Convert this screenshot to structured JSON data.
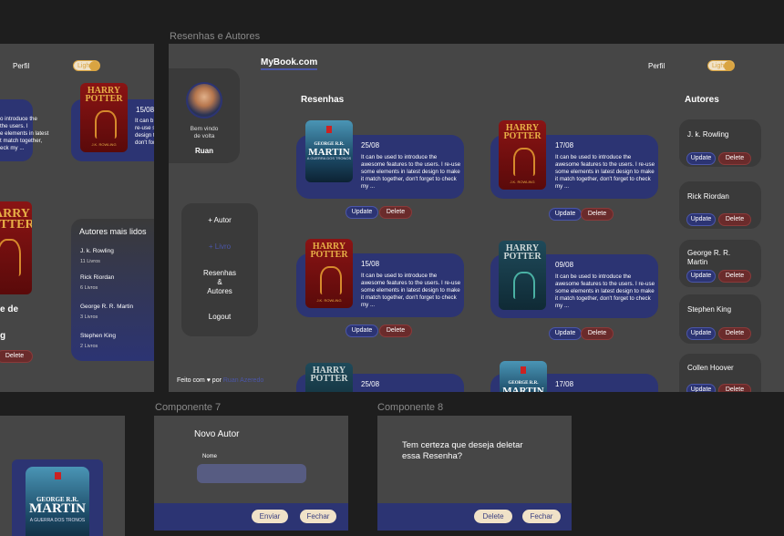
{
  "colors": {
    "background": "#1e1e1e",
    "frame": "#464646",
    "navy": "#2c3473",
    "card_dark": "#3a3a3a",
    "accent": "#d9a441",
    "delete": "#6a2b2b",
    "link": "#4b56a8"
  },
  "frame_labels": {
    "main": "Resenhas e Autores",
    "comp7": "Componente 7",
    "comp8": "Componente 8"
  },
  "left_frame": {
    "perfil": "Perfil",
    "toggle": "Light",
    "review_text_partial": [
      "o introduce the",
      "the users. I",
      "e elements in latest",
      "t match together,",
      "eck my ..."
    ],
    "review": {
      "date": "15/08",
      "text_partial": [
        "It can b",
        "re-use s",
        "design to",
        "don't for"
      ]
    },
    "autores_mais_lidos": {
      "title": "Autores mais lidos",
      "items": [
        {
          "name": "J. k. Rowling",
          "count": "11 Livros"
        },
        {
          "name": "Rick Riordan",
          "count": "6 Livros"
        },
        {
          "name": "George R. R. Martin",
          "count": "3 Livros"
        },
        {
          "name": "Stephen King",
          "count": "2 Livros"
        }
      ]
    },
    "partial_heading": "e de",
    "partial_heading2": "g",
    "delete_label": "Delete"
  },
  "main": {
    "brand": "MyBook.com",
    "perfil": "Perfil",
    "toggle": "Light",
    "welcome": {
      "greeting": "Bem vindo\nde volta",
      "name": "Ruan"
    },
    "nav": [
      {
        "label": "+ Autor"
      },
      {
        "label": "+ Livro"
      },
      {
        "label": "Resenhas\n&\nAutores"
      },
      {
        "label": "Logout"
      }
    ],
    "footer": {
      "prefix": "Feito com",
      "heart": "♥",
      "by": "por",
      "author": "Ruan Azeredo"
    },
    "resenhas_title": "Resenhas",
    "autores_title": "Autores",
    "update_label": "Update",
    "delete_label": "Delete",
    "reviews": [
      {
        "date": "25/08",
        "cover": "grrm",
        "text": "It can be used to introduce the awesome features to the users. I re-use some elements in latest design to make it match together, don't forget to check my ..."
      },
      {
        "date": "17/08",
        "cover": "hp",
        "text": "It can be used to introduce the awesome features to the users. I re-use some elements in latest design to make it match together, don't forget to check my ..."
      },
      {
        "date": "15/08",
        "cover": "hp",
        "text": "It can be used to introduce the awesome features to the users. I re-use some elements in latest design to make it match together, don't forget to check my ..."
      },
      {
        "date": "09/08",
        "cover": "hpg",
        "text": "It can be used to introduce the awesome features to the users. I re-use some elements in latest design to make it match together, don't forget to check my ..."
      },
      {
        "date": "25/08",
        "cover": "hpg",
        "text": ""
      },
      {
        "date": "17/08",
        "cover": "grrm",
        "text": ""
      }
    ],
    "authors": [
      {
        "name": "J. k. Rowling"
      },
      {
        "name": "Rick Riordan"
      },
      {
        "name": "George R. R.\nMartin"
      },
      {
        "name": "Stephen King"
      },
      {
        "name": "Collen Hoover"
      }
    ]
  },
  "book_covers": {
    "hp_title": "HARRY\nPOTTER",
    "hp_author": "J.K. ROWLING",
    "grrm_author": "GEORGE R.R.",
    "grrm_title": "MARTIN",
    "grrm_sub": "A GUERRA DOS TRONOS"
  },
  "comp7": {
    "title": "Novo Autor",
    "field_label": "Nome",
    "field_value": "",
    "submit": "Enviar",
    "close": "Fechar"
  },
  "comp8": {
    "question": "Tem certeza que deseja deletar\nessa Resenha?",
    "delete": "Delete",
    "close": "Fechar"
  }
}
